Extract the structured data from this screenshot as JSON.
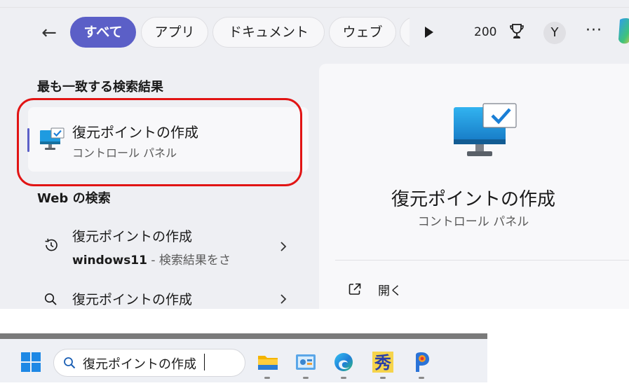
{
  "header": {
    "tabs": [
      {
        "label": "すべて",
        "active": true
      },
      {
        "label": "アプリ",
        "active": false
      },
      {
        "label": "ドキュメント",
        "active": false
      },
      {
        "label": "ウェブ",
        "active": false
      }
    ],
    "points": "200",
    "avatar_initial": "Y",
    "more_label": "···",
    "icons": [
      "back-arrow-icon",
      "play-icon",
      "trophy-icon",
      "more-icon",
      "copilot-icon"
    ]
  },
  "best_match": {
    "heading": "最も一致する検索結果",
    "title": "復元ポイントの作成",
    "subtitle": "コントロール パネル",
    "icon": "monitor-check-icon"
  },
  "web_search": {
    "heading": "Web の検索",
    "results": [
      {
        "line1": "復元ポイントの作成",
        "line2_strong": "windows11",
        "line2_hint": " - 検索結果をさ",
        "icon": "history-icon"
      },
      {
        "line1": "復元ポイントの作成",
        "icon": "search-icon"
      }
    ]
  },
  "preview": {
    "title": "復元ポイントの作成",
    "subtitle": "コントロール パネル",
    "actions": [
      {
        "label": "開く",
        "icon": "open-external-icon"
      }
    ]
  },
  "taskbar": {
    "search_value": "復元ポイントの作成",
    "apps": [
      "file-explorer-icon",
      "control-panel-icon",
      "edge-icon",
      "kanji-app-icon",
      "paint-app-icon"
    ]
  },
  "colors": {
    "accent": "#5b5fc7",
    "highlight_ring": "#e11414",
    "panel_bg": "#eeeff3",
    "card_bg": "#f8f8fa"
  }
}
